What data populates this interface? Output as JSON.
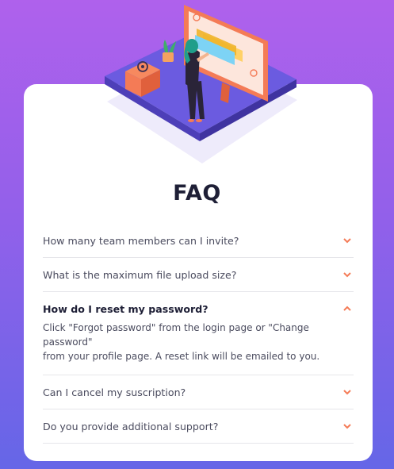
{
  "page": {
    "title": "FAQ"
  },
  "colors": {
    "accent": "#f47b56",
    "heading": "#1e1f36",
    "text": "#4a4b5e",
    "divider": "#e6e6ea"
  },
  "faq": {
    "items": [
      {
        "question": "How many team members can I invite?",
        "expanded": false,
        "icon": "chevron-down-icon"
      },
      {
        "question": "What is the maximum file upload size?",
        "expanded": false,
        "icon": "chevron-down-icon"
      },
      {
        "question": "How do I reset my password?",
        "expanded": true,
        "icon": "chevron-up-icon",
        "answer_line1": "Click \"Forgot password\" from the login page or \"Change password\"",
        "answer_line2": "from your profile page. A reset link will be emailed to you."
      },
      {
        "question": "Can I cancel my suscription?",
        "expanded": false,
        "icon": "chevron-down-icon"
      },
      {
        "question": "Do you provide additional support?",
        "expanded": false,
        "icon": "chevron-down-icon"
      }
    ]
  }
}
